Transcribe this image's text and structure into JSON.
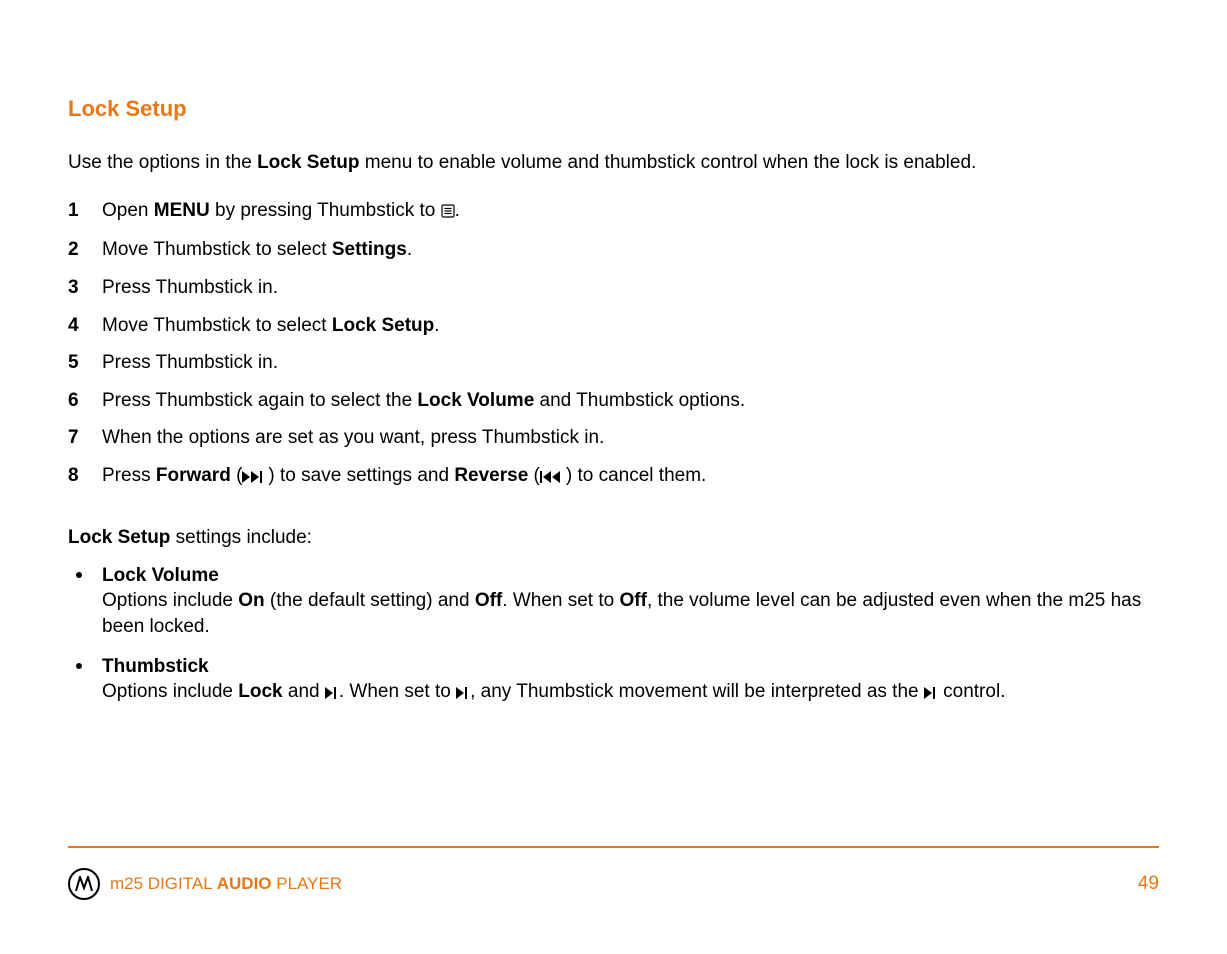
{
  "heading": "Lock Setup",
  "intro": {
    "pre": "Use the options in the ",
    "bold": "Lock Setup",
    "post": " menu to enable volume and thumbstick control when the lock is enabled."
  },
  "steps": {
    "s1": {
      "num": "1",
      "pre": "Open ",
      "b1": "MENU",
      "mid": " by pressing Thumbstick to ",
      "icon": "menu-icon",
      "post": "."
    },
    "s2": {
      "num": "2",
      "pre": "Move Thumbstick to select ",
      "b1": "Settings",
      "post": "."
    },
    "s3": {
      "num": "3",
      "text": "Press Thumbstick in."
    },
    "s4": {
      "num": "4",
      "pre": "Move Thumbstick to select ",
      "b1": "Lock Setup",
      "post": "."
    },
    "s5": {
      "num": "5",
      "text": "Press Thumbstick in."
    },
    "s6": {
      "num": "6",
      "pre": "Press Thumbstick again to select the ",
      "b1": "Lock Volume",
      "post": " and Thumbstick options."
    },
    "s7": {
      "num": "7",
      "text": "When the options are set as you want, press Thumbstick in."
    },
    "s8": {
      "num": "8",
      "pre": "Press ",
      "b1": "Forward",
      "mid1": " (",
      "icon1": "forward-icon",
      "mid2": ") to save settings and ",
      "b2": "Reverse",
      "mid3": " (",
      "icon2": "reverse-icon",
      "post": ") to cancel them."
    }
  },
  "settings_intro": {
    "b": "Lock Setup",
    "rest": " settings include:"
  },
  "bullets": {
    "lv": {
      "title": "Lock Volume",
      "p1": "Options include ",
      "b1": "On",
      "p2": " (the default setting) and ",
      "b2": "Off",
      "p3": ". When set to ",
      "b3": "Off",
      "p4": ", the volume level can be adjusted even when the m25 has been locked."
    },
    "ts": {
      "title": "Thumbstick",
      "p1": "Options include ",
      "b1": "Lock",
      "p2": " and ",
      "icon1": "play-next-icon",
      "p3": ". When set to ",
      "icon2": "play-next-icon",
      "p4": ", any Thumbstick movement will be interpreted as the ",
      "icon3": "play-next-icon",
      "p5": " control."
    }
  },
  "footer": {
    "brand_pre": "m25 DIGITAL ",
    "brand_b": "AUDIO",
    "brand_post": " PLAYER",
    "page": "49"
  }
}
